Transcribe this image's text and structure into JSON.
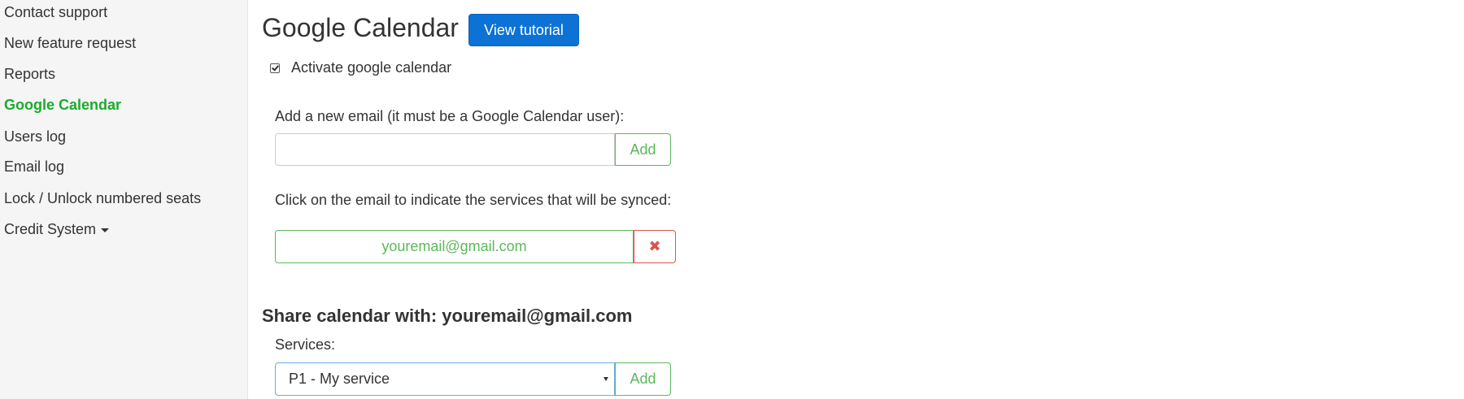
{
  "sidebar": {
    "items": [
      {
        "label": "Contact support",
        "active": false
      },
      {
        "label": "New feature request",
        "active": false
      },
      {
        "label": "Reports",
        "active": false
      },
      {
        "label": "Google Calendar",
        "active": true
      },
      {
        "label": "Users log",
        "active": false
      },
      {
        "label": "Email log",
        "active": false
      },
      {
        "label": "Lock / Unlock numbered seats",
        "active": false
      },
      {
        "label": "Credit System",
        "active": false,
        "has_dropdown": true
      }
    ]
  },
  "header": {
    "title": "Google Calendar",
    "tutorial_button": "View tutorial"
  },
  "activate": {
    "label": "Activate google calendar",
    "checked": true
  },
  "add_email": {
    "label": "Add a new email (it must be a Google Calendar user):",
    "value": "",
    "placeholder": "",
    "button": "Add"
  },
  "emails": {
    "instruction": "Click on the email to indicate the services that will be synced:",
    "items": [
      {
        "email": "youremail@gmail.com"
      }
    ],
    "remove_icon": "close-icon"
  },
  "share": {
    "title": "Share calendar with: youremail@gmail.com",
    "services_label": "Services:",
    "selected_service": "P1 - My service",
    "button": "Add"
  },
  "colors": {
    "active_link": "#1aac2a",
    "primary": "#0d72d6",
    "success": "#5cb85c",
    "danger": "#d9534f",
    "focus_border": "#66afe9",
    "sidebar_bg": "#f5f5f5"
  }
}
